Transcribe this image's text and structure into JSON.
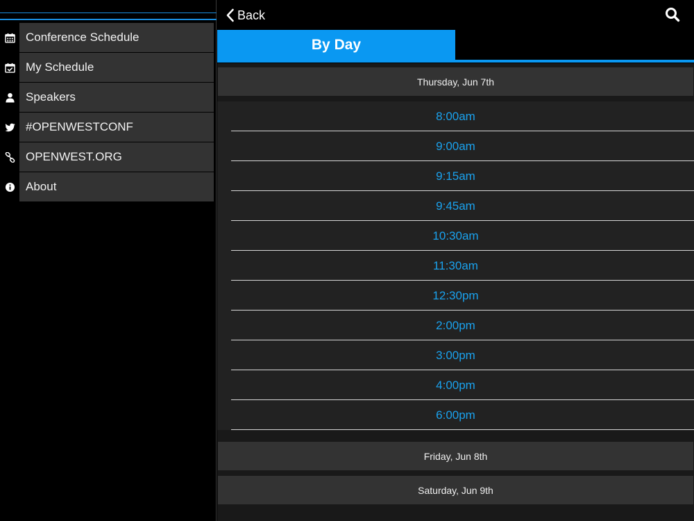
{
  "sidebar": {
    "items": [
      {
        "label": "Conference Schedule",
        "icon": "calendar-icon"
      },
      {
        "label": "My Schedule",
        "icon": "calendar-check-icon"
      },
      {
        "label": "Speakers",
        "icon": "user-icon"
      },
      {
        "label": "#OPENWESTCONF",
        "icon": "twitter-icon"
      },
      {
        "label": "OPENWEST.ORG",
        "icon": "link-icon"
      },
      {
        "label": "About",
        "icon": "info-icon"
      }
    ]
  },
  "header": {
    "back_label": "Back",
    "search_icon": "search-icon"
  },
  "tabs": {
    "active": "By Day"
  },
  "days": [
    {
      "label": "Thursday, Jun 7th",
      "times": [
        "8:00am",
        "9:00am",
        "9:15am",
        "9:45am",
        "10:30am",
        "11:30am",
        "12:30pm",
        "2:00pm",
        "3:00pm",
        "4:00pm",
        "6:00pm"
      ]
    },
    {
      "label": "Friday, Jun 8th"
    },
    {
      "label": "Saturday, Jun 9th"
    }
  ],
  "colors": {
    "accent": "#0a98f2",
    "time_text": "#1aa2ee"
  }
}
